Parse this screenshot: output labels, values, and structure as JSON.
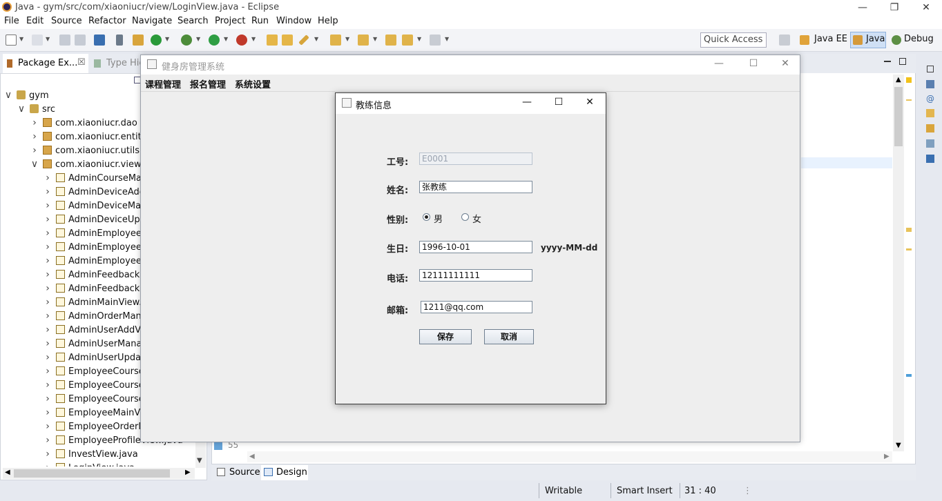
{
  "window": {
    "title": "Java - gym/src/com/xiaoniucr/view/LoginView.java - Eclipse"
  },
  "menu": [
    "File",
    "Edit",
    "Source",
    "Refactor",
    "Navigate",
    "Search",
    "Project",
    "Run",
    "Window",
    "Help"
  ],
  "toolbar": {
    "quick_access": "Quick Access",
    "perspectives": [
      "Java EE",
      "Java",
      "Debug"
    ]
  },
  "package_explorer": {
    "tabs": [
      "Package Ex...",
      "Type Hie"
    ],
    "tree": [
      {
        "label": "gym",
        "depth": 0,
        "type": "project",
        "expanded": true
      },
      {
        "label": "src",
        "depth": 1,
        "type": "srcfolder",
        "expanded": true
      },
      {
        "label": "com.xiaoniucr.dao",
        "depth": 2,
        "type": "package",
        "expanded": false
      },
      {
        "label": "com.xiaoniucr.entity",
        "depth": 2,
        "type": "package",
        "expanded": false
      },
      {
        "label": "com.xiaoniucr.utils",
        "depth": 2,
        "type": "package",
        "expanded": false
      },
      {
        "label": "com.xiaoniucr.view",
        "depth": 2,
        "type": "package",
        "expanded": true
      },
      {
        "label": "AdminCourseMan",
        "depth": 3,
        "type": "java"
      },
      {
        "label": "AdminDeviceAdd",
        "depth": 3,
        "type": "java"
      },
      {
        "label": "AdminDeviceMan",
        "depth": 3,
        "type": "java"
      },
      {
        "label": "AdminDeviceUpd",
        "depth": 3,
        "type": "java"
      },
      {
        "label": "AdminEmployeeA",
        "depth": 3,
        "type": "java"
      },
      {
        "label": "AdminEmployeeM",
        "depth": 3,
        "type": "java"
      },
      {
        "label": "AdminEmployeeU",
        "depth": 3,
        "type": "java"
      },
      {
        "label": "AdminFeedbackM",
        "depth": 3,
        "type": "java"
      },
      {
        "label": "AdminFeedbackR",
        "depth": 3,
        "type": "java"
      },
      {
        "label": "AdminMainView.j",
        "depth": 3,
        "type": "java"
      },
      {
        "label": "AdminOrderMana",
        "depth": 3,
        "type": "java"
      },
      {
        "label": "AdminUserAddVi",
        "depth": 3,
        "type": "java"
      },
      {
        "label": "AdminUserManag",
        "depth": 3,
        "type": "java"
      },
      {
        "label": "AdminUserUpdat",
        "depth": 3,
        "type": "java"
      },
      {
        "label": "EmployeeCourse",
        "depth": 3,
        "type": "java"
      },
      {
        "label": "EmployeeCourse",
        "depth": 3,
        "type": "java"
      },
      {
        "label": "EmployeeCourse",
        "depth": 3,
        "type": "java"
      },
      {
        "label": "EmployeeMainVie",
        "depth": 3,
        "type": "java"
      },
      {
        "label": "EmployeeOrderM",
        "depth": 3,
        "type": "java"
      },
      {
        "label": "EmployeeProfileView.java",
        "depth": 3,
        "type": "java"
      },
      {
        "label": "InvestView.java",
        "depth": 3,
        "type": "java"
      },
      {
        "label": "LoginView.java",
        "depth": 3,
        "type": "java"
      }
    ]
  },
  "editor": {
    "line_number": "55",
    "bottom_tabs": [
      "Source",
      "Design"
    ]
  },
  "status": {
    "writable": "Writable",
    "insert_mode": "Smart Insert",
    "position": "31 : 40"
  },
  "app_frame": {
    "title": "健身房管理系统",
    "menus": [
      "课程管理",
      "报名管理",
      "系统设置"
    ]
  },
  "dialog": {
    "title": "教练信息",
    "fields": {
      "id": {
        "label": "工号:",
        "value": "E0001"
      },
      "name": {
        "label": "姓名:",
        "value": "张教练"
      },
      "gender": {
        "label": "性别:",
        "options": [
          "男",
          "女"
        ],
        "selected": "男"
      },
      "birthday": {
        "label": "生日:",
        "value": "1996-10-01",
        "hint": "yyyy-MM-dd"
      },
      "phone": {
        "label": "电话:",
        "value": "12111111111"
      },
      "email": {
        "label": "邮箱:",
        "value": "1211@qq.com"
      }
    },
    "buttons": {
      "save": "保存",
      "cancel": "取消"
    }
  }
}
